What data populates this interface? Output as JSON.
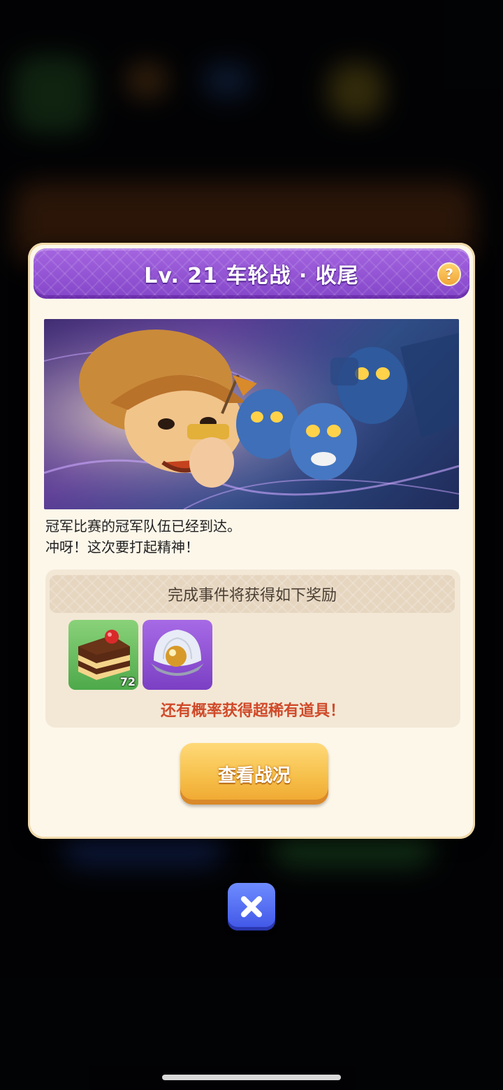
{
  "dialog": {
    "title": "Lv. 21 车轮战 · 收尾",
    "help_label": "?",
    "description_lines": [
      "冠军比赛的冠军队伍已经到达。",
      "冲呀！这次要打起精神！"
    ],
    "rewards": {
      "header": "完成事件将获得如下奖励",
      "items": [
        {
          "name": "cake",
          "count": "72"
        },
        {
          "name": "pearl-shell",
          "count": ""
        }
      ],
      "rare_note": "还有概率获得超稀有道具！"
    },
    "action_button_label": "查看战况"
  },
  "colors": {
    "title_purple": "#8e4fd2",
    "panel_cream": "#fdf7ea",
    "action_yellow": "#f6c04a",
    "rare_red": "#d04a2a",
    "close_blue": "#4a63ee"
  }
}
